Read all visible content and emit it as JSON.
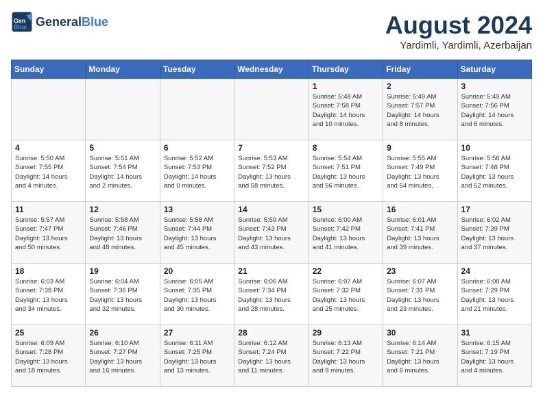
{
  "header": {
    "logo_general": "General",
    "logo_blue": "Blue",
    "month": "August 2024",
    "location": "Yardimli, Yardimli, Azerbaijan"
  },
  "days_of_week": [
    "Sunday",
    "Monday",
    "Tuesday",
    "Wednesday",
    "Thursday",
    "Friday",
    "Saturday"
  ],
  "weeks": [
    [
      {
        "num": "",
        "info": ""
      },
      {
        "num": "",
        "info": ""
      },
      {
        "num": "",
        "info": ""
      },
      {
        "num": "",
        "info": ""
      },
      {
        "num": "1",
        "info": "Sunrise: 5:48 AM\nSunset: 7:58 PM\nDaylight: 14 hours\nand 10 minutes."
      },
      {
        "num": "2",
        "info": "Sunrise: 5:49 AM\nSunset: 7:57 PM\nDaylight: 14 hours\nand 8 minutes."
      },
      {
        "num": "3",
        "info": "Sunrise: 5:49 AM\nSunset: 7:56 PM\nDaylight: 14 hours\nand 6 minutes."
      }
    ],
    [
      {
        "num": "4",
        "info": "Sunrise: 5:50 AM\nSunset: 7:55 PM\nDaylight: 14 hours\nand 4 minutes."
      },
      {
        "num": "5",
        "info": "Sunrise: 5:51 AM\nSunset: 7:54 PM\nDaylight: 14 hours\nand 2 minutes."
      },
      {
        "num": "6",
        "info": "Sunrise: 5:52 AM\nSunset: 7:53 PM\nDaylight: 14 hours\nand 0 minutes."
      },
      {
        "num": "7",
        "info": "Sunrise: 5:53 AM\nSunset: 7:52 PM\nDaylight: 13 hours\nand 58 minutes."
      },
      {
        "num": "8",
        "info": "Sunrise: 5:54 AM\nSunset: 7:51 PM\nDaylight: 13 hours\nand 56 minutes."
      },
      {
        "num": "9",
        "info": "Sunrise: 5:55 AM\nSunset: 7:49 PM\nDaylight: 13 hours\nand 54 minutes."
      },
      {
        "num": "10",
        "info": "Sunrise: 5:56 AM\nSunset: 7:48 PM\nDaylight: 13 hours\nand 52 minutes."
      }
    ],
    [
      {
        "num": "11",
        "info": "Sunrise: 5:57 AM\nSunset: 7:47 PM\nDaylight: 13 hours\nand 50 minutes."
      },
      {
        "num": "12",
        "info": "Sunrise: 5:58 AM\nSunset: 7:46 PM\nDaylight: 13 hours\nand 48 minutes."
      },
      {
        "num": "13",
        "info": "Sunrise: 5:58 AM\nSunset: 7:44 PM\nDaylight: 13 hours\nand 45 minutes."
      },
      {
        "num": "14",
        "info": "Sunrise: 5:59 AM\nSunset: 7:43 PM\nDaylight: 13 hours\nand 43 minutes."
      },
      {
        "num": "15",
        "info": "Sunrise: 6:00 AM\nSunset: 7:42 PM\nDaylight: 13 hours\nand 41 minutes."
      },
      {
        "num": "16",
        "info": "Sunrise: 6:01 AM\nSunset: 7:41 PM\nDaylight: 13 hours\nand 39 minutes."
      },
      {
        "num": "17",
        "info": "Sunrise: 6:02 AM\nSunset: 7:39 PM\nDaylight: 13 hours\nand 37 minutes."
      }
    ],
    [
      {
        "num": "18",
        "info": "Sunrise: 6:03 AM\nSunset: 7:38 PM\nDaylight: 13 hours\nand 34 minutes."
      },
      {
        "num": "19",
        "info": "Sunrise: 6:04 AM\nSunset: 7:36 PM\nDaylight: 13 hours\nand 32 minutes."
      },
      {
        "num": "20",
        "info": "Sunrise: 6:05 AM\nSunset: 7:35 PM\nDaylight: 13 hours\nand 30 minutes."
      },
      {
        "num": "21",
        "info": "Sunrise: 6:06 AM\nSunset: 7:34 PM\nDaylight: 13 hours\nand 28 minutes."
      },
      {
        "num": "22",
        "info": "Sunrise: 6:07 AM\nSunset: 7:32 PM\nDaylight: 13 hours\nand 25 minutes."
      },
      {
        "num": "23",
        "info": "Sunrise: 6:07 AM\nSunset: 7:31 PM\nDaylight: 13 hours\nand 23 minutes."
      },
      {
        "num": "24",
        "info": "Sunrise: 6:08 AM\nSunset: 7:29 PM\nDaylight: 13 hours\nand 21 minutes."
      }
    ],
    [
      {
        "num": "25",
        "info": "Sunrise: 6:09 AM\nSunset: 7:28 PM\nDaylight: 13 hours\nand 18 minutes."
      },
      {
        "num": "26",
        "info": "Sunrise: 6:10 AM\nSunset: 7:27 PM\nDaylight: 13 hours\nand 16 minutes."
      },
      {
        "num": "27",
        "info": "Sunrise: 6:11 AM\nSunset: 7:25 PM\nDaylight: 13 hours\nand 13 minutes."
      },
      {
        "num": "28",
        "info": "Sunrise: 6:12 AM\nSunset: 7:24 PM\nDaylight: 13 hours\nand 11 minutes."
      },
      {
        "num": "29",
        "info": "Sunrise: 6:13 AM\nSunset: 7:22 PM\nDaylight: 13 hours\nand 9 minutes."
      },
      {
        "num": "30",
        "info": "Sunrise: 6:14 AM\nSunset: 7:21 PM\nDaylight: 13 hours\nand 6 minutes."
      },
      {
        "num": "31",
        "info": "Sunrise: 6:15 AM\nSunset: 7:19 PM\nDaylight: 13 hours\nand 4 minutes."
      }
    ]
  ]
}
